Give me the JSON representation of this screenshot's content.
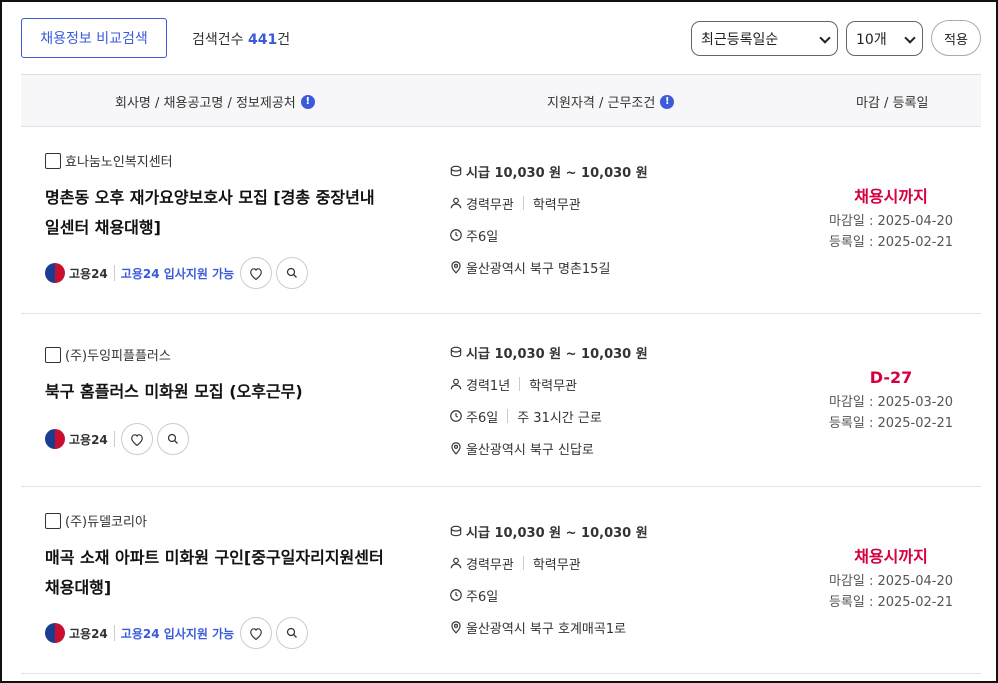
{
  "toolbar": {
    "compare_button": "채용정보 비교검색",
    "count_label": "검색건수",
    "count_value": "441",
    "count_unit": "건",
    "sort_value": "최근등록일순",
    "size_value": "10개",
    "apply_button": "적용"
  },
  "header": {
    "col1": "회사명 / 채용공고명 / 정보제공처",
    "col2": "지원자격 / 근무조건",
    "col3": "마감 / 등록일",
    "info_glyph": "!"
  },
  "jobs": [
    {
      "company": "효나눔노인복지센터",
      "title_line1": "명촌동 오후 재가요양보호사 모집 [경총 중장년내",
      "title_line2": "일센터 채용대행]",
      "source": "고용24",
      "apply_text": "고용24 입사지원 가능",
      "pay": "시급 10,030 원 ~ 10,030 원",
      "career": "경력무관",
      "education": "학력무관",
      "schedule": "주6일",
      "hours": "",
      "location": "울산광역시 북구 명촌15길",
      "deadline": "채용시까지",
      "close_date": "마감일 : 2025-04-20",
      "reg_date": "등록일 : 2025-02-21"
    },
    {
      "company": "(주)두잉피플플러스",
      "title_line1": "북구 홈플러스 미화원 모집 (오후근무)",
      "title_line2": "",
      "source": "고용24",
      "apply_text": "",
      "pay": "시급 10,030 원 ~ 10,030 원",
      "career": "경력1년",
      "education": "학력무관",
      "schedule": "주6일",
      "hours": "주 31시간 근로",
      "location": "울산광역시 북구 신답로",
      "deadline": "D-27",
      "close_date": "마감일 : 2025-03-20",
      "reg_date": "등록일 : 2025-02-21"
    },
    {
      "company": "(주)듀델코리아",
      "title_line1": "매곡 소재 아파트 미화원 구인[중구일자리지원센터",
      "title_line2": "채용대행]",
      "source": "고용24",
      "apply_text": "고용24 입사지원 가능",
      "pay": "시급 10,030 원 ~ 10,030 원",
      "career": "경력무관",
      "education": "학력무관",
      "schedule": "주6일",
      "hours": "",
      "location": "울산광역시 북구 호계매곡1로",
      "deadline": "채용시까지",
      "close_date": "마감일 : 2025-04-20",
      "reg_date": "등록일 : 2025-02-21"
    }
  ]
}
